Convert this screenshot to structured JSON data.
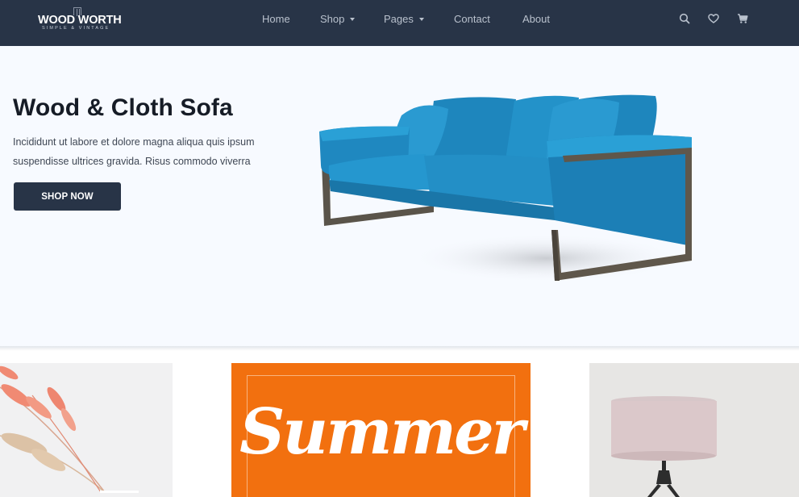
{
  "brand": {
    "name": "WOOD WORTH",
    "tagline": "SIMPLE & VINTAGE"
  },
  "nav": {
    "items": [
      {
        "label": "Home"
      },
      {
        "label": "Shop"
      },
      {
        "label": "Pages"
      },
      {
        "label": "Contact"
      },
      {
        "label": "About"
      }
    ],
    "icons": [
      "search-icon",
      "heart-icon",
      "cart-icon"
    ]
  },
  "hero": {
    "title": "Wood & Cloth Sofa",
    "line1": "Incididunt ut labore et dolore magna aliqua quis ipsum",
    "line2": "suspendisse ultrices gravida. Risus commodo viverra",
    "button": "SHOP NOW",
    "product_color": "#2390c8"
  },
  "tiles": {
    "summer_text": "Summer",
    "summer_bg": "#f2700f"
  },
  "colors": {
    "navbar": "#283447",
    "hero_bg": "#f7faff"
  }
}
